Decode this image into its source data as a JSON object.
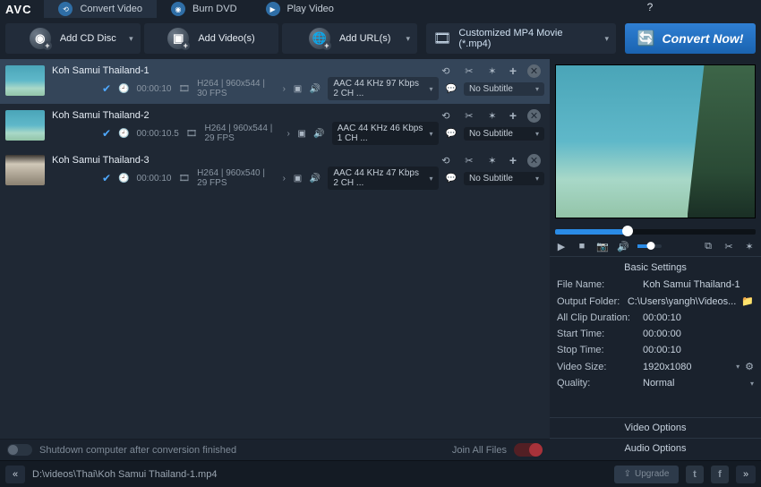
{
  "app": {
    "logo": "AVC"
  },
  "titlebar_tabs": [
    {
      "label": "Convert Video",
      "icon": "convert-icon",
      "active": true
    },
    {
      "label": "Burn DVD",
      "icon": "disc-icon",
      "active": false
    },
    {
      "label": "Play Video",
      "icon": "play-icon",
      "active": false
    }
  ],
  "toolbar": {
    "add_cd": "Add CD Disc",
    "add_videos": "Add Video(s)",
    "add_urls": "Add URL(s)",
    "profile": "Customized MP4 Movie (*.mp4)",
    "convert": "Convert Now!"
  },
  "files": [
    {
      "title": "Koh Samui Thailand-1",
      "selected": true,
      "duration": "00:00:10",
      "vinfo": "H264 | 960x544 | 30 FPS",
      "audio": "AAC 44 KHz 97 Kbps 2 CH ...",
      "subtitle": "No Subtitle",
      "thumb": "beach"
    },
    {
      "title": "Koh Samui Thailand-2",
      "selected": false,
      "duration": "00:00:10.5",
      "vinfo": "H264 | 960x544 | 29 FPS",
      "audio": "AAC 44 KHz 46 Kbps 1 CH ...",
      "subtitle": "No Subtitle",
      "thumb": "beach"
    },
    {
      "title": "Koh Samui Thailand-3",
      "selected": false,
      "duration": "00:00:10",
      "vinfo": "H264 | 960x540 | 29 FPS",
      "audio": "AAC 44 KHz 47 Kbps 2 CH ...",
      "subtitle": "No Subtitle",
      "thumb": "room"
    }
  ],
  "left_bottom": {
    "shutdown": "Shutdown computer after conversion finished",
    "join": "Join All Files"
  },
  "settings": {
    "header": "Basic Settings",
    "file_name_label": "File Name:",
    "file_name": "Koh Samui Thailand-1",
    "output_folder_label": "Output Folder:",
    "output_folder": "C:\\Users\\yangh\\Videos...",
    "all_clip_label": "All Clip Duration:",
    "all_clip": "00:00:10",
    "start_label": "Start Time:",
    "start": "00:00:00",
    "stop_label": "Stop Time:",
    "stop": "00:00:10",
    "size_label": "Video Size:",
    "size": "1920x1080",
    "quality_label": "Quality:",
    "quality": "Normal",
    "video_options": "Video Options",
    "audio_options": "Audio Options"
  },
  "statusbar": {
    "path": "D:\\videos\\Thai\\Koh Samui Thailand-1.mp4",
    "upgrade": "Upgrade"
  }
}
